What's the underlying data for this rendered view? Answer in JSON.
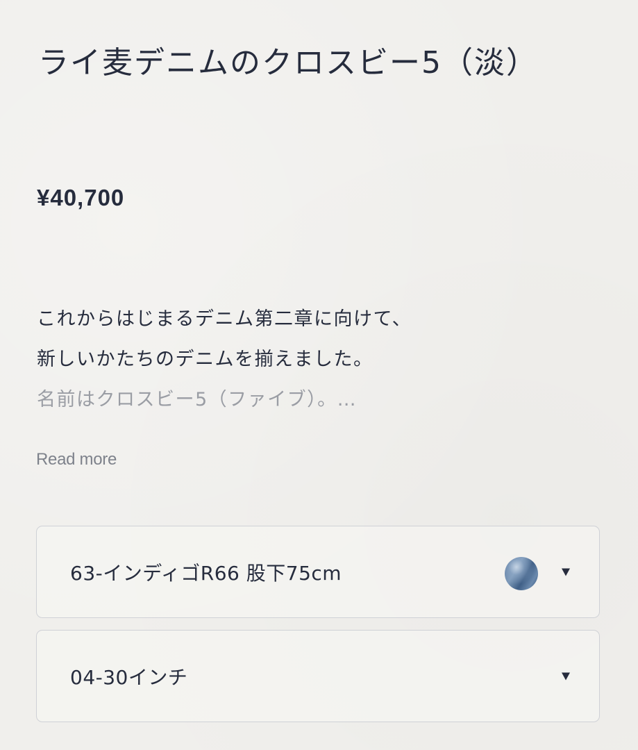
{
  "product": {
    "title": "ライ麦デニムのクロスビー5（淡）",
    "price": "¥40,700"
  },
  "description": {
    "lines": [
      "これからはじまるデニム第二章に向けて、",
      "新しいかたちのデニムを揃えました。",
      "名前はクロスビー5（ファイブ）。…"
    ],
    "read_more_label": "Read more"
  },
  "variant_selectors": {
    "color": {
      "selected": "63-インディゴR66 股下75cm",
      "swatch_icon": "indigo-swatch",
      "swatch_color": "#5a7aa0",
      "caret_icon": "caret-down-icon"
    },
    "size": {
      "selected": "04-30インチ",
      "caret_icon": "caret-down-icon"
    }
  },
  "colors": {
    "background": "#f0efec",
    "text": "#262c3d",
    "muted_text": "#9a9da4",
    "border": "#cfd1d6"
  }
}
